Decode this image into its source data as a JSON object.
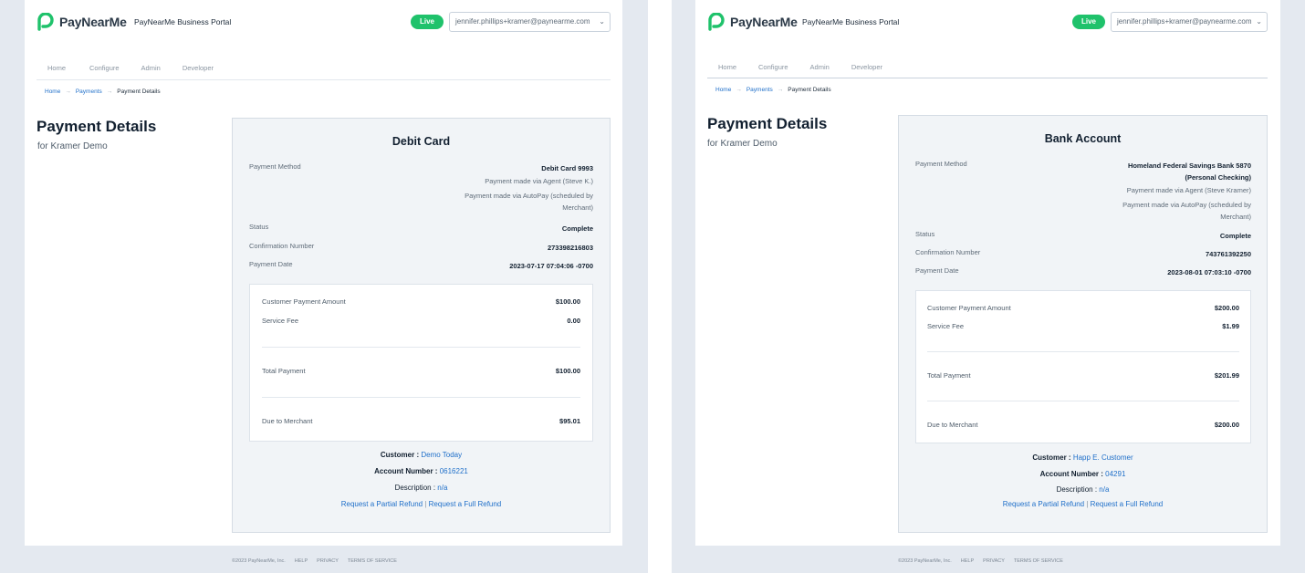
{
  "brand": {
    "name": "PayNearMe",
    "accent": "#1fc26b",
    "link_color": "#1f6fc9"
  },
  "header": {
    "portal_title": "PayNearMe Business Portal",
    "live_label": "Live",
    "user": "jennifer.phillips+kramer@paynearme.com",
    "chevron": "chevron-down-icon"
  },
  "nav": {
    "items": [
      "Home",
      "Configure",
      "Admin",
      "Developer"
    ]
  },
  "breadcrumb": {
    "home": "Home",
    "payments": "Payments",
    "current": "Payment Details",
    "sep": "→"
  },
  "page": {
    "title": "Payment Details",
    "subtitle": "for Kramer Demo"
  },
  "left": {
    "heading": "Debit Card",
    "labels": {
      "method": "Payment Method",
      "status": "Status",
      "confirmation": "Confirmation Number",
      "date": "Payment Date"
    },
    "method_value": "Debit Card 9993",
    "method_sub1": "Payment made via Agent (Steve K.)",
    "method_sub2": "Payment made via AutoPay (scheduled by",
    "method_sub3": "Merchant)",
    "status_value": "Complete",
    "confirmation_value": "273398216803",
    "date_value": "2023-07-17 07:04:06 -0700",
    "summary": {
      "customer_amount_label": "Customer Payment Amount",
      "customer_amount": "$100.00",
      "fee_label": "Service Fee",
      "fee": "0.00",
      "total_label": "Total Payment",
      "total": "$100.00",
      "due_label": "Due to Merchant",
      "due": "$95.01"
    },
    "customer_label": "Customer :",
    "customer": "Demo Today",
    "account_label": "Account Number :",
    "account": "0616221",
    "description_label": "Description :",
    "description": "n/a",
    "partial_refund": "Request a Partial Refund",
    "full_refund": "Request a Full Refund",
    "refund_sep": "|"
  },
  "right": {
    "heading": "Bank Account",
    "labels": {
      "method": "Payment Method",
      "status": "Status",
      "confirmation": "Confirmation Number",
      "date": "Payment Date"
    },
    "method_value1": "Homeland Federal Savings Bank 5870",
    "method_value2": "(Personal Checking)",
    "method_sub1": "Payment made via Agent (Steve Kramer)",
    "method_sub2": "Payment made via AutoPay (scheduled by",
    "method_sub3": "Merchant)",
    "status_value": "Complete",
    "confirmation_value": "743761392250",
    "date_value": "2023-08-01 07:03:10 -0700",
    "summary": {
      "customer_amount_label": "Customer Payment Amount",
      "customer_amount": "$200.00",
      "fee_label": "Service Fee",
      "fee": "$1.99",
      "total_label": "Total Payment",
      "total": "$201.99",
      "due_label": "Due to Merchant",
      "due": "$200.00"
    },
    "customer_label": "Customer :",
    "customer": "Happ E. Customer",
    "account_label": "Account Number :",
    "account": "04291",
    "description_label": "Description :",
    "description": "n/a",
    "partial_refund": "Request a Partial Refund",
    "full_refund": "Request a Full Refund",
    "refund_sep": "|"
  },
  "footer": {
    "copyright": "©2023 PayNearMe, Inc.",
    "help": "HELP",
    "privacy": "PRIVACY",
    "terms": "TERMS OF SERVICE"
  }
}
